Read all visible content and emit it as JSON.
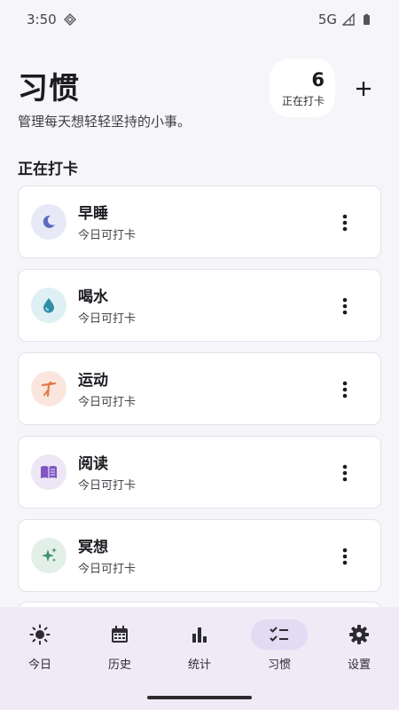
{
  "status_bar": {
    "time": "3:50",
    "network": "5G"
  },
  "header": {
    "title": "习惯",
    "subtitle": "管理每天想轻轻坚持的小事。",
    "active_count": "6",
    "active_count_label": "正在打卡"
  },
  "section_title": "正在打卡",
  "habits": [
    {
      "name": "早睡",
      "status": "今日可打卡",
      "icon": "moon-icon",
      "bg": "#e8e9f7",
      "color": "#5c6bc0"
    },
    {
      "name": "喝水",
      "status": "今日可打卡",
      "icon": "water-drop-icon",
      "bg": "#dff0f4",
      "color": "#2f8fa8"
    },
    {
      "name": "运动",
      "status": "今日可打卡",
      "icon": "exercise-icon",
      "bg": "#fbe6dd",
      "color": "#e07a4a"
    },
    {
      "name": "阅读",
      "status": "今日可打卡",
      "icon": "book-icon",
      "bg": "#ece6f6",
      "color": "#7e57c2"
    },
    {
      "name": "冥想",
      "status": "今日可打卡",
      "icon": "sparkle-icon",
      "bg": "#e3efe9",
      "color": "#3e8e6c"
    }
  ],
  "nav": [
    {
      "label": "今日",
      "icon": "sun-icon",
      "active": false
    },
    {
      "label": "历史",
      "icon": "calendar-icon",
      "active": false
    },
    {
      "label": "统计",
      "icon": "bar-chart-icon",
      "active": false
    },
    {
      "label": "习惯",
      "icon": "checklist-icon",
      "active": true
    },
    {
      "label": "设置",
      "icon": "gear-icon",
      "active": false
    }
  ],
  "colors": {
    "accent_bg": "#e3daf3",
    "nav_bg": "#f0eaf7",
    "page_bg": "#f6f5f9"
  }
}
